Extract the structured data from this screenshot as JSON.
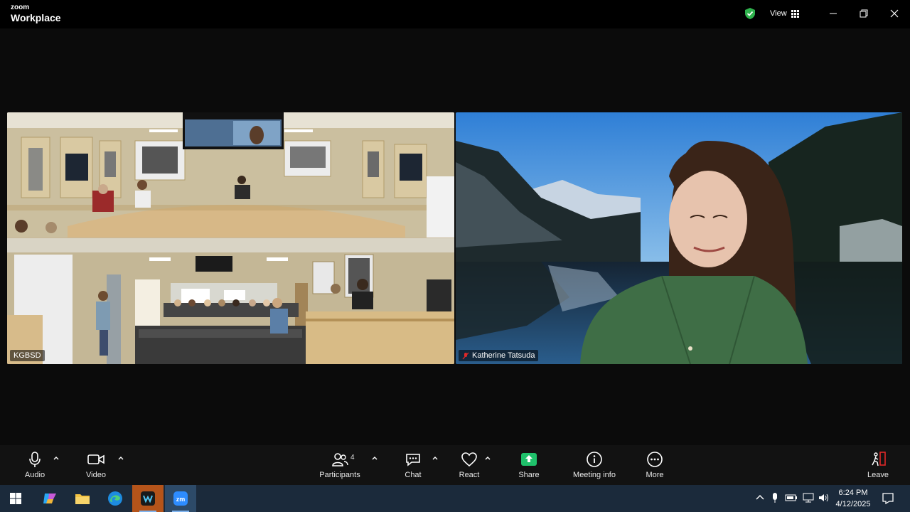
{
  "app": {
    "brand_top": "zoom",
    "brand_bottom": "Workplace"
  },
  "titlebar": {
    "view_label": "View"
  },
  "participants": [
    {
      "name": "KGBSD"
    },
    {
      "name": "Katherine Tatsuda"
    }
  ],
  "toolbar": {
    "audio": "Audio",
    "video": "Video",
    "participants": "Participants",
    "participants_count": "4",
    "chat": "Chat",
    "react": "React",
    "share": "Share",
    "meeting_info": "Meeting info",
    "more": "More",
    "leave": "Leave"
  },
  "colors": {
    "share_green": "#1fc16b",
    "shield_green": "#2fb24d",
    "leave_red": "#e02828"
  },
  "taskbar": {
    "time": "6:24 PM",
    "date": "4/12/2025"
  }
}
